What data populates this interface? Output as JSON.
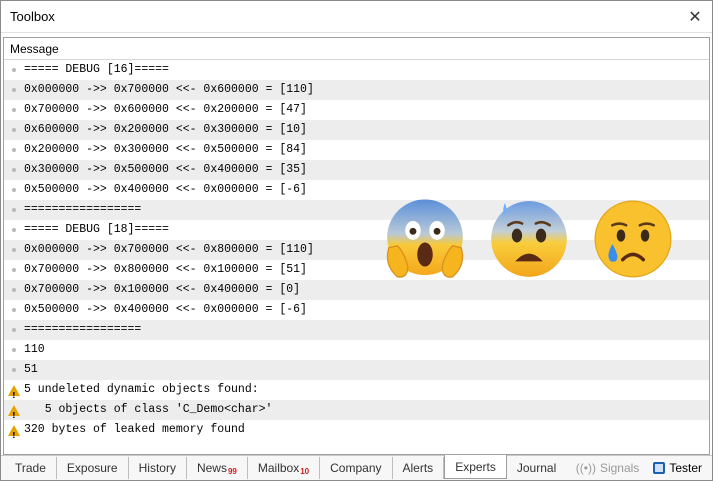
{
  "window": {
    "title": "Toolbox"
  },
  "panel": {
    "header": "Message"
  },
  "rows": [
    {
      "icon": "dot",
      "text": "===== DEBUG [16]====="
    },
    {
      "icon": "dot",
      "text": "0x000000 ->> 0x700000 <<- 0x600000 = [110]"
    },
    {
      "icon": "dot",
      "text": "0x700000 ->> 0x600000 <<- 0x200000 = [47]"
    },
    {
      "icon": "dot",
      "text": "0x600000 ->> 0x200000 <<- 0x300000 = [10]"
    },
    {
      "icon": "dot",
      "text": "0x200000 ->> 0x300000 <<- 0x500000 = [84]"
    },
    {
      "icon": "dot",
      "text": "0x300000 ->> 0x500000 <<- 0x400000 = [35]"
    },
    {
      "icon": "dot",
      "text": "0x500000 ->> 0x400000 <<- 0x000000 = [-6]"
    },
    {
      "icon": "dot",
      "text": "================="
    },
    {
      "icon": "dot",
      "text": "===== DEBUG [18]====="
    },
    {
      "icon": "dot",
      "text": "0x000000 ->> 0x700000 <<- 0x800000 = [110]"
    },
    {
      "icon": "dot",
      "text": "0x700000 ->> 0x800000 <<- 0x100000 = [51]"
    },
    {
      "icon": "dot",
      "text": "0x700000 ->> 0x100000 <<- 0x400000 = [0]"
    },
    {
      "icon": "dot",
      "text": "0x500000 ->> 0x400000 <<- 0x000000 = [-6]"
    },
    {
      "icon": "dot",
      "text": "================="
    },
    {
      "icon": "dot",
      "text": "110"
    },
    {
      "icon": "dot",
      "text": "51"
    },
    {
      "icon": "warning",
      "text": "5 undeleted dynamic objects found:"
    },
    {
      "icon": "warning",
      "text": "   5 objects of class 'C_Demo<char>'"
    },
    {
      "icon": "warning",
      "text": "320 bytes of leaked memory found"
    }
  ],
  "overlay_emojis": [
    "screaming-face-icon",
    "anxious-face-icon",
    "crying-face-icon"
  ],
  "tabs": [
    {
      "label": "Trade"
    },
    {
      "label": "Exposure"
    },
    {
      "label": "History"
    },
    {
      "label": "News",
      "badge": "99"
    },
    {
      "label": "Mailbox",
      "badge": "10"
    },
    {
      "label": "Company"
    },
    {
      "label": "Alerts"
    },
    {
      "label": "Experts",
      "active": true
    },
    {
      "label": "Journal"
    }
  ],
  "right_items": {
    "signals": "Signals",
    "tester": "Tester"
  },
  "colors": {
    "warning": "#e8a300",
    "badge": "#d41a1a",
    "odd_row": "#ededed"
  }
}
